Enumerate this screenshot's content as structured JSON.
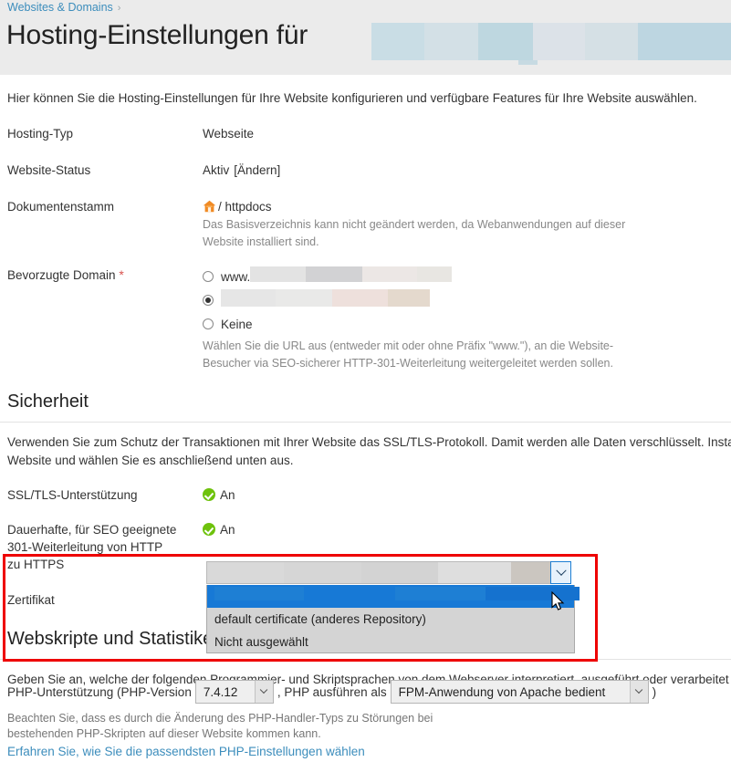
{
  "breadcrumb": {
    "item": "Websites & Domains",
    "separator": "›"
  },
  "header": {
    "title": "Hosting-Einstellungen für",
    "title_redacted_blocks": [
      {
        "width": 58,
        "color": "#c9dde5"
      },
      {
        "width": 59,
        "color": "#d3e0e6"
      },
      {
        "width": 60,
        "color": "#bed7e0"
      },
      {
        "width": 57,
        "color": "#dce2e8"
      },
      {
        "width": 58,
        "color": "#d5e0e5"
      },
      {
        "width": 102,
        "color": "#bdd6e1"
      }
    ]
  },
  "intro": "Hier können Sie die Hosting-Einstellungen für Ihre Website konfigurieren und verfügbare Features für Ihre Website auswählen.",
  "rows": {
    "hosting_type": {
      "label": "Hosting-Typ",
      "value": "Webseite"
    },
    "website_status": {
      "label": "Website-Status",
      "value": "Aktiv",
      "action": "[Ändern]"
    },
    "document_root": {
      "label": "Dokumentenstamm",
      "icon": "home-icon",
      "value": "/ httpdocs",
      "hint_line1": "Das Basisverzeichnis kann nicht geändert werden, da Webanwendungen auf dieser",
      "hint_line2": "Website installiert sind."
    },
    "preferred_domain": {
      "label": "Bevorzugte Domain",
      "required_marker": "*",
      "option_www_prefix": "www.",
      "option_www_blocks": [
        {
          "width": 61,
          "color": "#e3e3e3"
        },
        {
          "width": 62,
          "color": "#d2d2d4"
        },
        {
          "width": 60,
          "color": "#ece7e5"
        },
        {
          "width": 38,
          "color": "#e8e6e2"
        }
      ],
      "option_plain_blocks": [
        {
          "width": 60,
          "color": "#e6e6e6"
        },
        {
          "width": 62,
          "color": "#e9e9e8"
        },
        {
          "width": 61,
          "color": "#eee0dc"
        },
        {
          "width": 46,
          "color": "#e4d9cd"
        }
      ],
      "option_none": "Keine",
      "selected_index": 1,
      "hint_line1": "Wählen Sie die URL aus (entweder mit oder ohne Präfix \"www.\"), an die Website-",
      "hint_line2": "Besucher via SEO-sicherer HTTP-301-Weiterleitung weitergeleitet werden sollen."
    }
  },
  "security": {
    "heading": "Sicherheit",
    "para_line1": "Verwenden Sie zum Schutz der Transaktionen mit Ihrer Website das SSL/TLS-Protokoll. Damit werden alle Daten verschlüsselt. Installieren Sie zunächst ein Zertifikat auf der",
    "para_line2": "Website und wählen Sie es anschließend unten aus.",
    "ssl_support": {
      "label": "SSL/TLS-Unterstützung",
      "value": "An"
    },
    "redirect": {
      "label_line1": "Dauerhafte, für SEO geeignete",
      "label_line2": "301-Weiterleitung von HTTP",
      "label_line3": "zu HTTPS",
      "value": "An"
    },
    "certificate": {
      "label": "Zertifikat",
      "selected_blocks": [
        {
          "width": 84,
          "color": "#d9d9d9"
        },
        {
          "width": 85,
          "color": "#d6d6d6"
        },
        {
          "width": 84,
          "color": "#d3d3d3"
        },
        {
          "width": 80,
          "color": "#dedede"
        },
        {
          "width": 44,
          "color": "#cbc6c0"
        }
      ],
      "options": [
        {
          "label": "",
          "redacted": true,
          "selected": true,
          "blocks": [
            {
              "width": 98,
              "color": "#1e7fd4"
            },
            {
              "width": 100,
              "color": "#1779d6"
            },
            {
              "width": 99,
              "color": "#1e7fd4"
            },
            {
              "width": 103,
              "color": "#1572cf"
            }
          ]
        },
        {
          "label": "default certificate (anderes Repository)",
          "redacted": false,
          "selected": false
        },
        {
          "label": "Nicht ausgewählt",
          "redacted": false,
          "selected": false
        }
      ]
    }
  },
  "webscripts": {
    "heading": "Webskripte und Statistiken",
    "para": "Geben Sie an, welche der folgenden Programmier- und Skriptsprachen von dem Webserver interpretiert, ausgeführt oder verarbeitet werden.",
    "php": {
      "prefix": "PHP-Unterstützung (PHP-Version",
      "version_value": "7.4.12",
      "middle": ", PHP ausführen als",
      "handler_value": "FPM-Anwendung von Apache bedient",
      "suffix": ")",
      "note_line1": "Beachten Sie, dass es durch die Änderung des PHP-Handler-Typs zu Störungen bei",
      "note_line2": "bestehenden PHP-Skripten auf dieser Website kommen kann.",
      "link": "Erfahren Sie, wie Sie die passendsten PHP-Einstellungen wählen"
    }
  },
  "colors": {
    "accent_link": "#3c8dbc",
    "header_band": "#ebebeb",
    "status_green": "#6ec20c",
    "annotation_red": "#ee0000",
    "select_highlight": "#1779d6"
  }
}
